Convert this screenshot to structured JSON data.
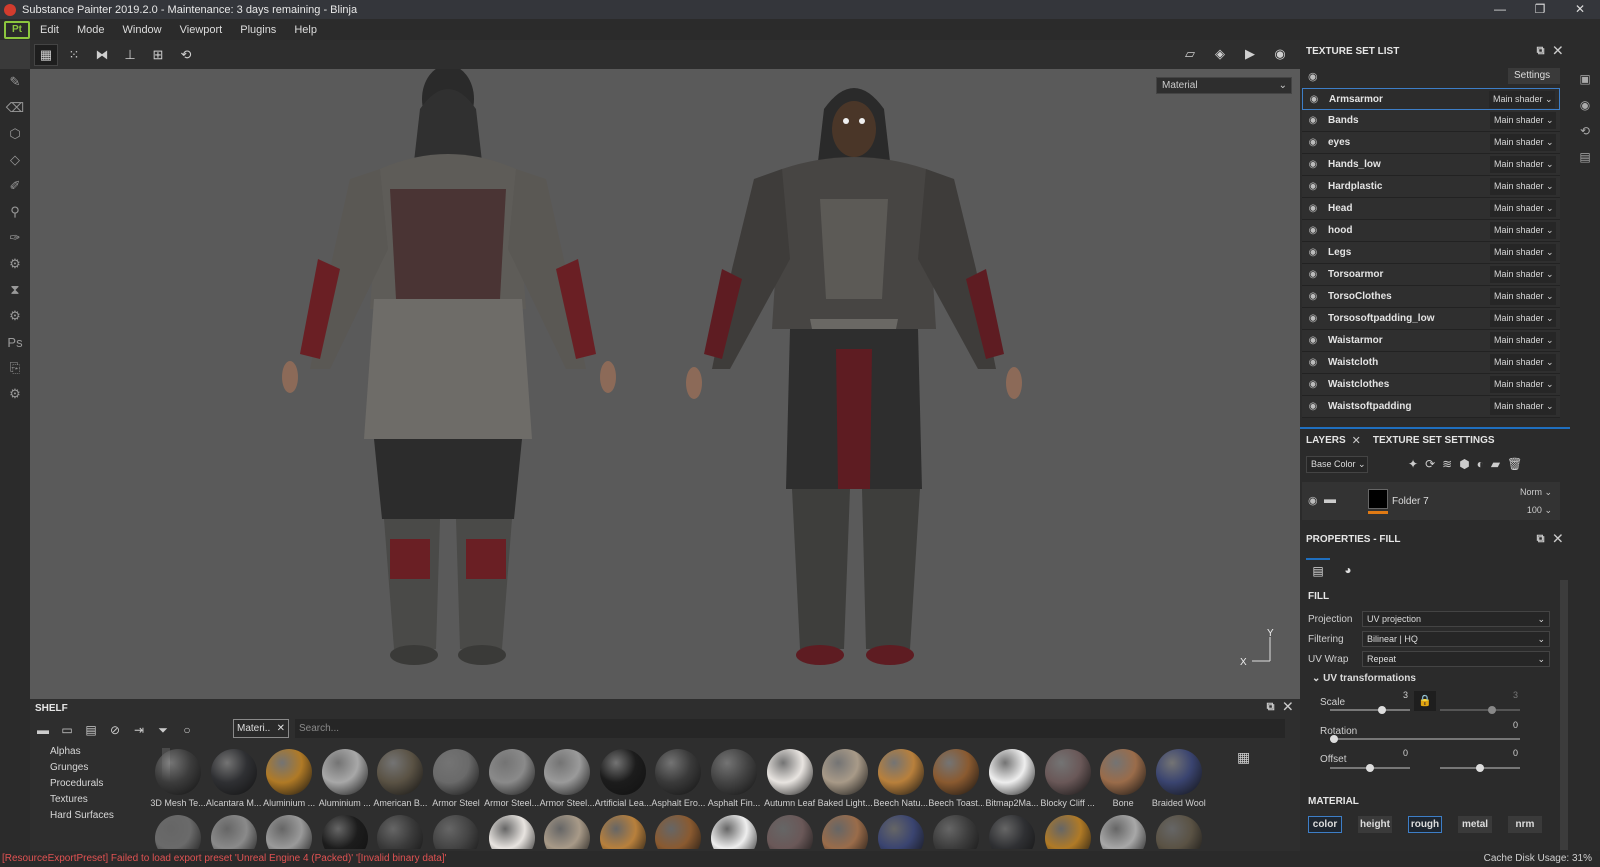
{
  "window": {
    "title": "Substance Painter 2019.2.0 - Maintenance: 3 days remaining - Blinja",
    "controls": [
      "—",
      "❐",
      "✕"
    ]
  },
  "app_logo": "Pt",
  "menu": [
    "Edit",
    "Mode",
    "Window",
    "Viewport",
    "Plugins",
    "Help"
  ],
  "viewport": {
    "mode_select": "Material",
    "axis_x": "X",
    "axis_y": "Y"
  },
  "shelf": {
    "title": "SHELF",
    "filter_chip": "Materi..",
    "search_placeholder": "Search...",
    "categories": [
      "Alphas",
      "Grunges",
      "Procedurals",
      "Textures",
      "Hard Surfaces"
    ],
    "materials": [
      {
        "name": "3D Mesh Te...",
        "color": "#3c3c3c"
      },
      {
        "name": "Alcantara M...",
        "color": "#2f3033"
      },
      {
        "name": "Aluminium ...",
        "color": "#b07a26"
      },
      {
        "name": "Aluminium ...",
        "color": "#a8a8a8"
      },
      {
        "name": "American B...",
        "color": "#5a5244"
      },
      {
        "name": "Armor Steel",
        "color": "#6a6a6a"
      },
      {
        "name": "Armor Steel...",
        "color": "#8a8a8a"
      },
      {
        "name": "Armor Steel...",
        "color": "#9a9a9a"
      },
      {
        "name": "Artificial Lea...",
        "color": "#1c1c1c"
      },
      {
        "name": "Asphalt Ero...",
        "color": "#3a3a3a"
      },
      {
        "name": "Asphalt Fin...",
        "color": "#444444"
      },
      {
        "name": "Autumn Leaf",
        "color": "#e8e4e0"
      },
      {
        "name": "Baked Light...",
        "color": "#a89a88"
      },
      {
        "name": "Beech Natu...",
        "color": "#b8803c"
      },
      {
        "name": "Beech Toast...",
        "color": "#8a5a30"
      },
      {
        "name": "Bitmap2Ma...",
        "color": "#eeeeee"
      },
      {
        "name": "Blocky Cliff ...",
        "color": "#6a5858"
      },
      {
        "name": "Bone",
        "color": "#9a6c4a"
      },
      {
        "name": "Braided Wool",
        "color": "#3a4470"
      }
    ]
  },
  "texture_set_list": {
    "title": "TEXTURE SET LIST",
    "settings": "Settings",
    "items": [
      {
        "name": "Armsarmor",
        "shader": "Main shader"
      },
      {
        "name": "Bands",
        "shader": "Main shader"
      },
      {
        "name": "eyes",
        "shader": "Main shader"
      },
      {
        "name": "Hands_low",
        "shader": "Main shader"
      },
      {
        "name": "Hardplastic",
        "shader": "Main shader"
      },
      {
        "name": "Head",
        "shader": "Main shader"
      },
      {
        "name": "hood",
        "shader": "Main shader"
      },
      {
        "name": "Legs",
        "shader": "Main shader"
      },
      {
        "name": "Torsoarmor",
        "shader": "Main shader"
      },
      {
        "name": "TorsoClothes",
        "shader": "Main shader"
      },
      {
        "name": "Torsosoftpadding_low",
        "shader": "Main shader"
      },
      {
        "name": "Waistarmor",
        "shader": "Main shader"
      },
      {
        "name": "Waistcloth",
        "shader": "Main shader"
      },
      {
        "name": "Waistclothes",
        "shader": "Main shader"
      },
      {
        "name": "Waistsoftpadding",
        "shader": "Main shader"
      }
    ]
  },
  "layers": {
    "tab_layers": "LAYERS",
    "tab_tss": "TEXTURE SET SETTINGS",
    "channel": "Base Color",
    "layer": {
      "name": "Folder 7",
      "blend": "Norm",
      "opacity": "100"
    }
  },
  "properties": {
    "title": "PROPERTIES - FILL",
    "section": "FILL",
    "projection_label": "Projection",
    "projection": "UV projection",
    "filtering_label": "Filtering",
    "filtering": "Bilinear | HQ",
    "uvwrap_label": "UV Wrap",
    "uvwrap": "Repeat",
    "uvt_label": "UV transformations",
    "scale_label": "Scale",
    "scale_value": "3",
    "scale_value2": "3",
    "rotation_label": "Rotation",
    "rotation_value": "0",
    "offset_label": "Offset",
    "offset_value": "0",
    "offset_value2": "0",
    "material_section": "MATERIAL",
    "channels": [
      "color",
      "height",
      "rough",
      "metal",
      "nrm"
    ]
  },
  "status": {
    "error": "[ResourceExportPreset] Failed to load export preset 'Unreal Engine 4 (Packed)' '[Invalid binary data]'",
    "cache": "Cache Disk Usage:  31%"
  }
}
